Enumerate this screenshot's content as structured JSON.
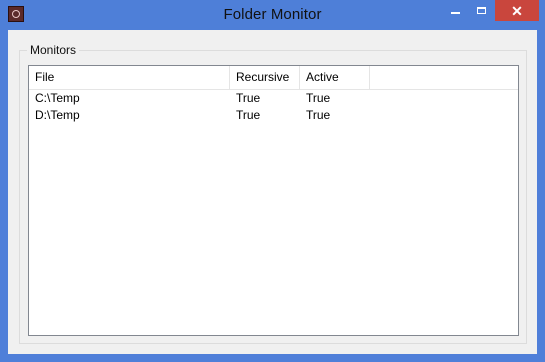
{
  "window": {
    "title": "Folder Monitor",
    "controls": {
      "minimize": "minimize",
      "maximize": "maximize",
      "close": "✕"
    }
  },
  "group": {
    "label": "Monitors"
  },
  "table": {
    "columns": [
      "File",
      "Recursive",
      "Active"
    ],
    "rows": [
      {
        "file": "C:\\Temp",
        "recursive": "True",
        "active": "True"
      },
      {
        "file": "D:\\Temp",
        "recursive": "True",
        "active": "True"
      }
    ]
  },
  "colors": {
    "titlebar": "#4e7fd8",
    "close": "#c9463d",
    "client": "#f0f0f0"
  }
}
